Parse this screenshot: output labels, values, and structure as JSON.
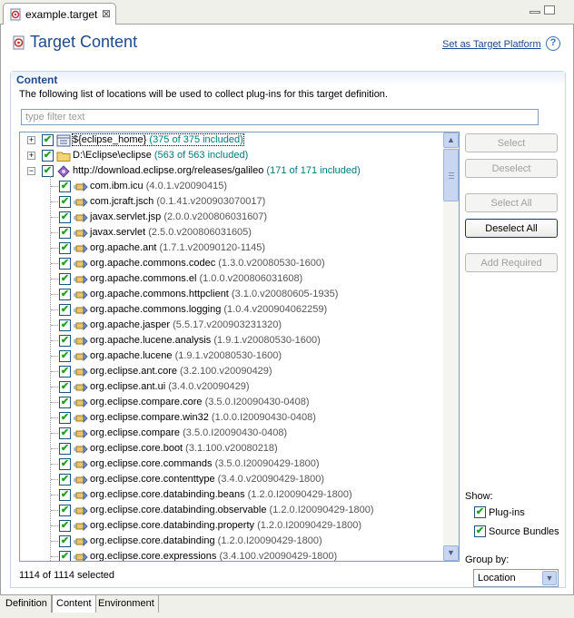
{
  "editor_tab": {
    "label": "example.target",
    "close_glyph": "⊠"
  },
  "header": {
    "title": "Target Content",
    "set_platform_link": "Set as Target Platform",
    "help_glyph": "?"
  },
  "section": {
    "title": "Content",
    "description": "The following list of locations will be used to collect plug-ins for this target definition.",
    "filter_placeholder": "type filter text"
  },
  "tree": {
    "locations": [
      {
        "name": "${eclipse_home}",
        "included": "(375 of 375 included)",
        "icon": "target-home-icon",
        "expander": "+"
      },
      {
        "name": "D:\\Eclipse\\eclipse",
        "included": "(563 of 563 included)",
        "icon": "folder-icon",
        "expander": "+"
      },
      {
        "name": "http://download.eclipse.org/releases/galileo",
        "included": "(171 of 171 included)",
        "icon": "update-site-icon",
        "expander": "−"
      }
    ],
    "plugins": [
      {
        "name": "com.ibm.icu",
        "version": "(4.0.1.v20090415)"
      },
      {
        "name": "com.jcraft.jsch",
        "version": "(0.1.41.v200903070017)"
      },
      {
        "name": "javax.servlet.jsp",
        "version": "(2.0.0.v200806031607)"
      },
      {
        "name": "javax.servlet",
        "version": "(2.5.0.v200806031605)"
      },
      {
        "name": "org.apache.ant",
        "version": "(1.7.1.v20090120-1145)"
      },
      {
        "name": "org.apache.commons.codec",
        "version": "(1.3.0.v20080530-1600)"
      },
      {
        "name": "org.apache.commons.el",
        "version": "(1.0.0.v200806031608)"
      },
      {
        "name": "org.apache.commons.httpclient",
        "version": "(3.1.0.v20080605-1935)"
      },
      {
        "name": "org.apache.commons.logging",
        "version": "(1.0.4.v200904062259)"
      },
      {
        "name": "org.apache.jasper",
        "version": "(5.5.17.v200903231320)"
      },
      {
        "name": "org.apache.lucene.analysis",
        "version": "(1.9.1.v20080530-1600)"
      },
      {
        "name": "org.apache.lucene",
        "version": "(1.9.1.v20080530-1600)"
      },
      {
        "name": "org.eclipse.ant.core",
        "version": "(3.2.100.v20090429)"
      },
      {
        "name": "org.eclipse.ant.ui",
        "version": "(3.4.0.v20090429)"
      },
      {
        "name": "org.eclipse.compare.core",
        "version": "(3.5.0.I20090430-0408)"
      },
      {
        "name": "org.eclipse.compare.win32",
        "version": "(1.0.0.I20090430-0408)"
      },
      {
        "name": "org.eclipse.compare",
        "version": "(3.5.0.I20090430-0408)"
      },
      {
        "name": "org.eclipse.core.boot",
        "version": "(3.1.100.v20080218)"
      },
      {
        "name": "org.eclipse.core.commands",
        "version": "(3.5.0.I20090429-1800)"
      },
      {
        "name": "org.eclipse.core.contenttype",
        "version": "(3.4.0.v20090429-1800)"
      },
      {
        "name": "org.eclipse.core.databinding.beans",
        "version": "(1.2.0.I20090429-1800)"
      },
      {
        "name": "org.eclipse.core.databinding.observable",
        "version": "(1.2.0.I20090429-1800)"
      },
      {
        "name": "org.eclipse.core.databinding.property",
        "version": "(1.2.0.I20090429-1800)"
      },
      {
        "name": "org.eclipse.core.databinding",
        "version": "(1.2.0.I20090429-1800)"
      },
      {
        "name": "org.eclipse.core.expressions",
        "version": "(3.4.100.v20090429-1800)"
      }
    ],
    "check_glyph": "✔",
    "plugin_icon": "plugin-icon"
  },
  "buttons": {
    "select": "Select",
    "deselect": "Deselect",
    "select_all": "Select All",
    "deselect_all": "Deselect All",
    "add_required": "Add Required"
  },
  "show": {
    "label": "Show:",
    "plugins": "Plug-ins",
    "source_bundles": "Source Bundles"
  },
  "group_by": {
    "label": "Group by:",
    "value": "Location"
  },
  "selection_count": "1114 of 1114 selected",
  "bottom_tabs": [
    "Definition",
    "Content",
    "Environment"
  ],
  "colors": {
    "title": "#1c4a8c",
    "included_count": "#007a7a",
    "check": "#21a121"
  }
}
